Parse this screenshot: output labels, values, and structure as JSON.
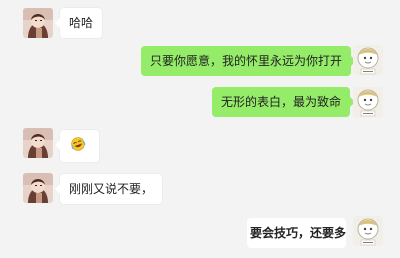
{
  "messages": [
    {
      "side": "left",
      "text": "哈哈"
    },
    {
      "side": "right",
      "text": "只要你愿意，我的怀里永远为你打开"
    },
    {
      "side": "right",
      "text": "无形的表白，最为致命"
    },
    {
      "side": "left",
      "emoji": "laughing-crying-emoji"
    },
    {
      "side": "left",
      "text": "刚刚又说不要，"
    },
    {
      "side": "right",
      "text": "要会技巧，还要多加"
    }
  ],
  "avatars": {
    "left": "girl-photo-avatar",
    "right": "cartoon-character-avatar"
  },
  "colors": {
    "background": "#f3f3f3",
    "outgoing_bubble": "#95ec69",
    "incoming_bubble": "#ffffff"
  }
}
